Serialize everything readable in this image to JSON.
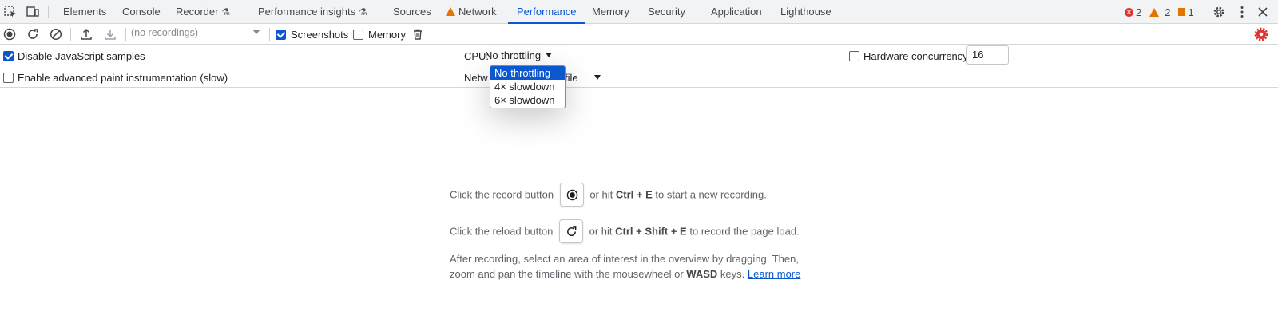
{
  "tabs": [
    {
      "label": "Elements"
    },
    {
      "label": "Console"
    },
    {
      "label": "Recorder",
      "flask": true
    },
    {
      "label": "Performance insights",
      "flask": true
    },
    {
      "label": "Sources"
    },
    {
      "label": "Network",
      "warning": true
    },
    {
      "label": "Performance",
      "active": true
    },
    {
      "label": "Memory"
    },
    {
      "label": "Security"
    },
    {
      "label": "Application"
    },
    {
      "label": "Lighthouse"
    }
  ],
  "counters": {
    "errors": "2",
    "warnings": "2",
    "issues": "1"
  },
  "toolbar": {
    "recordings_placeholder": "(no recordings)",
    "screenshots_label": "Screenshots",
    "screenshots_checked": true,
    "memory_label": "Memory",
    "memory_checked": false
  },
  "settings": {
    "disable_js_samples_label": "Disable JavaScript samples",
    "disable_js_samples_checked": true,
    "advanced_paint_label": "Enable advanced paint instrumentation (slow)",
    "advanced_paint_checked": false,
    "cpu_label": "CPU:",
    "cpu_value": "No throttling",
    "network_label_visible": "Netw",
    "network_value_visible": "file",
    "hardware_concurrency_label": "Hardware concurrency",
    "hardware_concurrency_checked": false,
    "hardware_concurrency_value": "16"
  },
  "cpu_dropdown": {
    "options": [
      "No throttling",
      "4× slowdown",
      "6× slowdown"
    ],
    "selected": "No throttling"
  },
  "landing": {
    "record_pre": "Click the record button",
    "record_mid": "or hit",
    "record_keys": "Ctrl + E",
    "record_post": "to start a new recording.",
    "reload_pre": "Click the reload button",
    "reload_mid": "or hit",
    "reload_keys": "Ctrl + Shift + E",
    "reload_post": "to record the page load.",
    "after_line1": "After recording, select an area of interest in the overview by dragging. Then,",
    "after_line2_pre": "zoom and pan the timeline with the mousewheel or",
    "after_line2_keys": "WASD",
    "after_line2_post": "keys.",
    "learn_more": "Learn more"
  },
  "colors": {
    "accent": "#0b57d0",
    "error": "#dc362e",
    "warning": "#e37400",
    "settings_gear": "#dc362e"
  }
}
